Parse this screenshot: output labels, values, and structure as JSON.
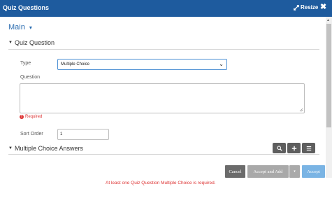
{
  "window": {
    "title": "Quiz Questions",
    "resize_label": "Resize",
    "close_glyph": "✖"
  },
  "nav": {
    "main_label": "Main",
    "caret": "▾"
  },
  "quiz_question": {
    "heading": "Quiz Question",
    "type_label": "Type",
    "type_value": "Multiple Choice",
    "question_label": "Question",
    "question_value": "",
    "required_text": "Required",
    "sort_order_label": "Sort Order",
    "sort_order_value": "1"
  },
  "answers": {
    "heading": "Multiple Choice Answers",
    "error_text": "At least one Quiz Question Multiple Choice is required."
  },
  "footer": {
    "cancel_label": "Cancel",
    "accept_add_label": "Accept and Add",
    "dropdown_glyph": "▾",
    "accept_label": "Accept"
  },
  "icons": {
    "resize": "resize-icon",
    "close": "close-icon",
    "search": "search-icon",
    "add": "plus-icon",
    "menu": "menu-icon",
    "error": "exclamation-icon"
  },
  "colors": {
    "titlebar": "#1e5b9e",
    "link": "#2a6cb0",
    "error": "#dd3333",
    "accept": "#7ab4e4",
    "cancel": "#6b6b6b"
  }
}
